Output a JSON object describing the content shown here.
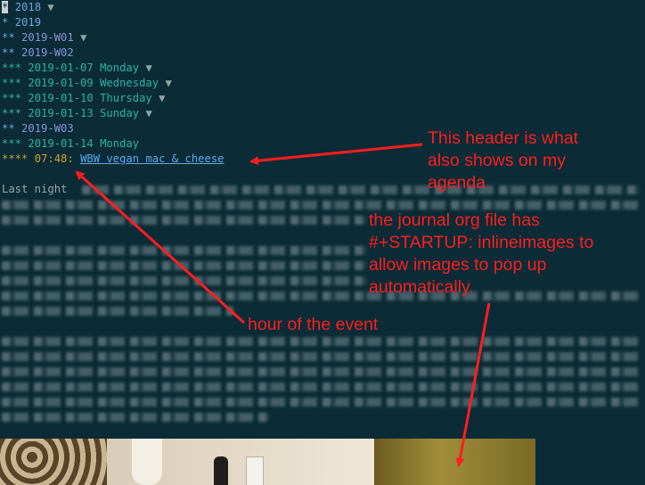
{
  "org": {
    "lines": [
      {
        "stars": "*",
        "title": "2018",
        "fold": "▼"
      },
      {
        "stars": "*",
        "title": "2019",
        "fold": ""
      },
      {
        "stars": "**",
        "title": "2019-W01",
        "fold": "▼"
      },
      {
        "stars": "**",
        "title": "2019-W02",
        "fold": ""
      },
      {
        "stars": "***",
        "title": "2019-01-07 Monday",
        "fold": "▼"
      },
      {
        "stars": "***",
        "title": "2019-01-09 Wednesday",
        "fold": "▼"
      },
      {
        "stars": "***",
        "title": "2019-01-10 Thursday",
        "fold": "▼"
      },
      {
        "stars": "***",
        "title": "2019-01-13 Sunday",
        "fold": "▼"
      },
      {
        "stars": "**",
        "title": "2019-W03",
        "fold": ""
      },
      {
        "stars": "***",
        "title": "2019-01-14 Monday",
        "fold": ""
      }
    ],
    "entry": {
      "stars": "****",
      "time": "07:48:",
      "link": "WBW vegan mac & cheese"
    },
    "body_start": "Last night"
  },
  "annotations": {
    "header": [
      "This header is what",
      "also shows on my",
      "agenda"
    ],
    "startup": [
      "the journal org file has",
      "#+STARTUP: inlineimages to",
      "allow images to pop up",
      "automatically."
    ],
    "hour": [
      "hour of the event"
    ]
  },
  "colors": {
    "background": "#0b2b36",
    "annotation": "#ff1e1e",
    "level1": "#6aa7e0",
    "level2": "#8b95d8",
    "level3": "#2bb3a6",
    "level4": "#c9a32b",
    "link": "#5fa9e8"
  }
}
